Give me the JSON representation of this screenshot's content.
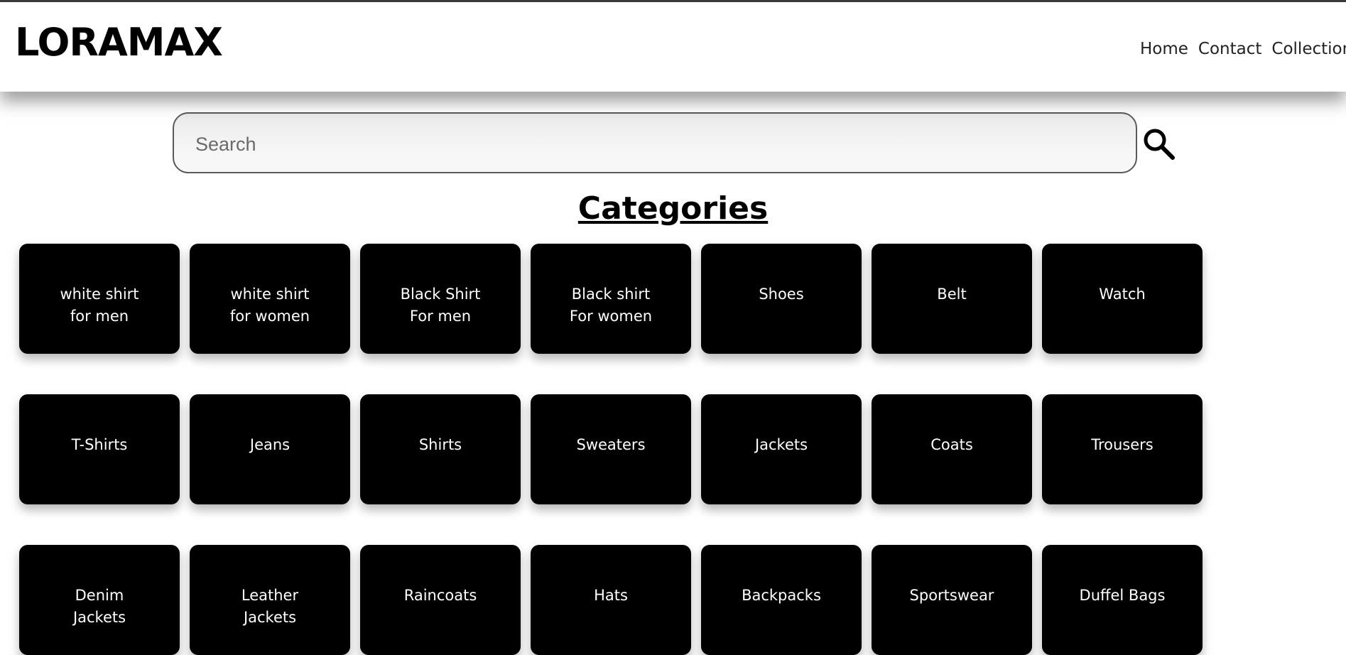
{
  "header": {
    "logo": "LORAMAX",
    "nav": [
      "Home",
      "Contact",
      "Collection"
    ]
  },
  "search": {
    "placeholder": "Search",
    "value": "",
    "icon": "search-icon"
  },
  "categories": {
    "title": "Categories",
    "items": [
      "white shirt for men",
      "white shirt for women",
      "Black Shirt For men",
      "Black shirt For women",
      "Shoes",
      "Belt",
      "Watch",
      "T-Shirts",
      "Jeans",
      "Shirts",
      "Sweaters",
      "Jackets",
      "Coats",
      "Trousers",
      "Denim Jackets",
      "Leather Jackets",
      "Raincoats",
      "Hats",
      "Backpacks",
      "Sportswear",
      "Duffel Bags"
    ]
  },
  "colors": {
    "tile_bg": "#000000",
    "tile_text": "#ffffff",
    "page_bg": "#ffffff"
  }
}
